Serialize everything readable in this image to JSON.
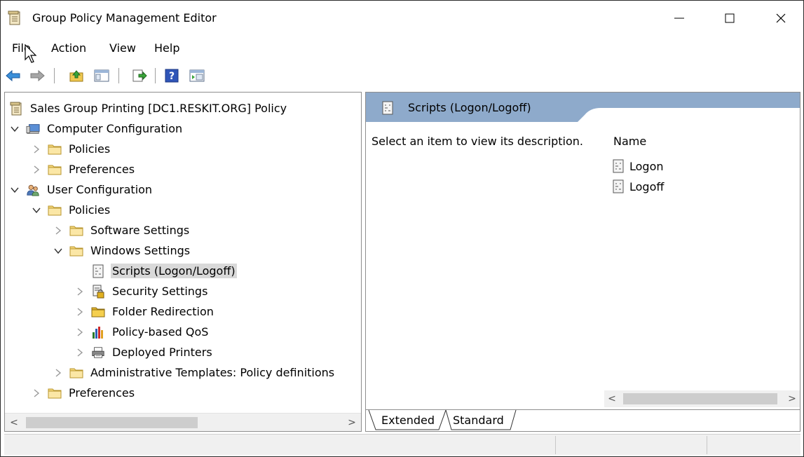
{
  "window": {
    "title": "Group Policy Management Editor",
    "controls": {
      "minimize": "—",
      "maximize": "☐",
      "close": "✕"
    }
  },
  "menu": [
    "File",
    "Action",
    "View",
    "Help"
  ],
  "toolbar": {
    "icons": [
      "back-icon",
      "forward-icon",
      "up-folder-icon",
      "show-hide-tree-icon",
      "export-list-icon",
      "help-icon",
      "properties-icon"
    ]
  },
  "tree": [
    {
      "label": "Sales Group Printing [DC1.RESKIT.ORG] Policy",
      "depth": 0,
      "expander": "",
      "icon": "policy-icon"
    },
    {
      "label": "Computer Configuration",
      "depth": 0,
      "expander": "expanded",
      "icon": "computer-icon"
    },
    {
      "label": "Policies",
      "depth": 1,
      "expander": "collapsed",
      "icon": "folder-icon"
    },
    {
      "label": "Preferences",
      "depth": 1,
      "expander": "collapsed",
      "icon": "folder-icon"
    },
    {
      "label": "User Configuration",
      "depth": 0,
      "expander": "expanded",
      "icon": "users-icon"
    },
    {
      "label": "Policies",
      "depth": 1,
      "expander": "expanded",
      "icon": "folder-icon"
    },
    {
      "label": "Software Settings",
      "depth": 2,
      "expander": "collapsed",
      "icon": "folder-icon"
    },
    {
      "label": "Windows Settings",
      "depth": 2,
      "expander": "expanded",
      "icon": "folder-icon"
    },
    {
      "label": "Scripts (Logon/Logoff)",
      "depth": 3,
      "expander": "",
      "icon": "script-icon",
      "selected": true
    },
    {
      "label": "Security Settings",
      "depth": 3,
      "expander": "collapsed",
      "icon": "security-icon"
    },
    {
      "label": "Folder Redirection",
      "depth": 3,
      "expander": "collapsed",
      "icon": "folder-redirect-icon"
    },
    {
      "label": "Policy-based QoS",
      "depth": 3,
      "expander": "collapsed",
      "icon": "chart-icon"
    },
    {
      "label": "Deployed Printers",
      "depth": 3,
      "expander": "collapsed",
      "icon": "printer-icon"
    },
    {
      "label": "Administrative Templates: Policy definitions",
      "depth": 2,
      "expander": "collapsed",
      "icon": "folder-icon"
    },
    {
      "label": "Preferences",
      "depth": 1,
      "expander": "collapsed",
      "icon": "folder-icon"
    }
  ],
  "details": {
    "header": "Scripts (Logon/Logoff)",
    "description": "Select an item to view its description.",
    "column": "Name",
    "items": [
      "Logon",
      "Logoff"
    ],
    "tabs": [
      "Extended",
      "Standard"
    ],
    "active_tab": "Extended"
  },
  "colors": {
    "header_blue": "#8eaacb",
    "selection_gray": "#d9d9d9",
    "folder_yellow": "#f5d77b"
  }
}
